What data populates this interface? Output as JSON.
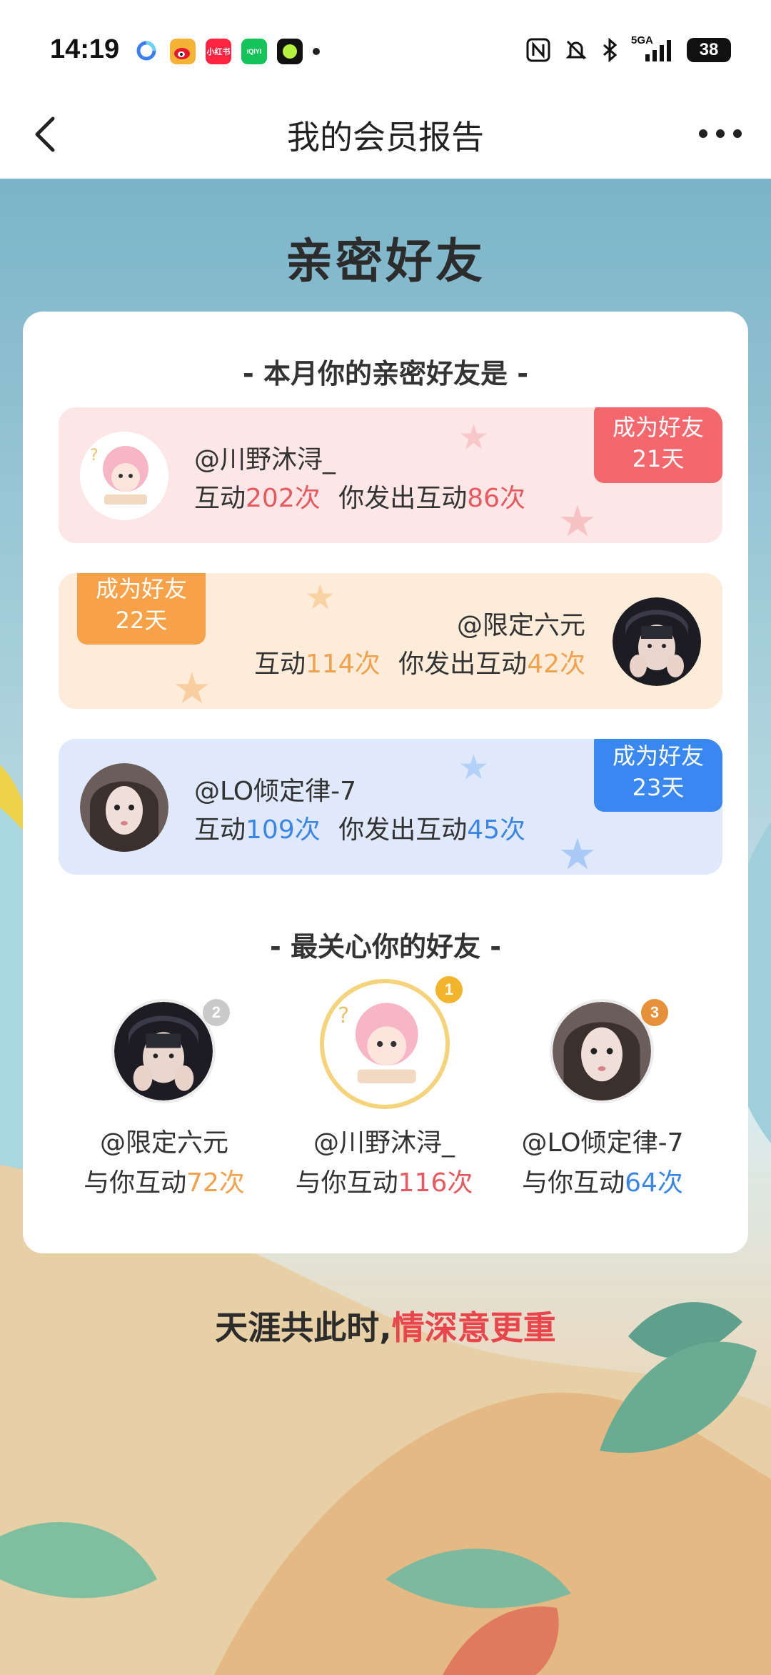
{
  "status_bar": {
    "time": "14:19",
    "battery": "38",
    "network": "5GA"
  },
  "nav": {
    "title": "我的会员报告"
  },
  "section_title": "亲密好友",
  "monthly": {
    "heading": "- 本月你的亲密好友是 -",
    "friends": [
      {
        "name": "@川野沐浔_",
        "interact_prefix": "互动",
        "interact_count": "202次",
        "sent_prefix": "你发出互动",
        "sent_count": "86次",
        "badge_line1": "成为好友",
        "badge_line2": "21天",
        "color": "#f4686d"
      },
      {
        "name": "@限定六元",
        "interact_prefix": "互动",
        "interact_count": "114次",
        "sent_prefix": "你发出互动",
        "sent_count": "42次",
        "badge_line1": "成为好友",
        "badge_line2": "22天",
        "color": "#f7a248"
      },
      {
        "name": "@LO倾定律-7",
        "interact_prefix": "互动",
        "interact_count": "109次",
        "sent_prefix": "你发出互动",
        "sent_count": "45次",
        "badge_line1": "成为好友",
        "badge_line2": "23天",
        "color": "#3987f0"
      }
    ]
  },
  "caring": {
    "heading": "- 最关心你的好友 -",
    "friends": [
      {
        "rank": "2",
        "name": "@限定六元",
        "prefix": "与你互动",
        "count": "72次",
        "color": "#f2a14c"
      },
      {
        "rank": "1",
        "name": "@川野沐浔_",
        "prefix": "与你互动",
        "count": "116次",
        "color": "#e8585f"
      },
      {
        "rank": "3",
        "name": "@LO倾定律-7",
        "prefix": "与你互动",
        "count": "64次",
        "color": "#3a86e6"
      }
    ]
  },
  "slogan": {
    "part1": "天涯共此时,",
    "part2": "情深意更重"
  }
}
